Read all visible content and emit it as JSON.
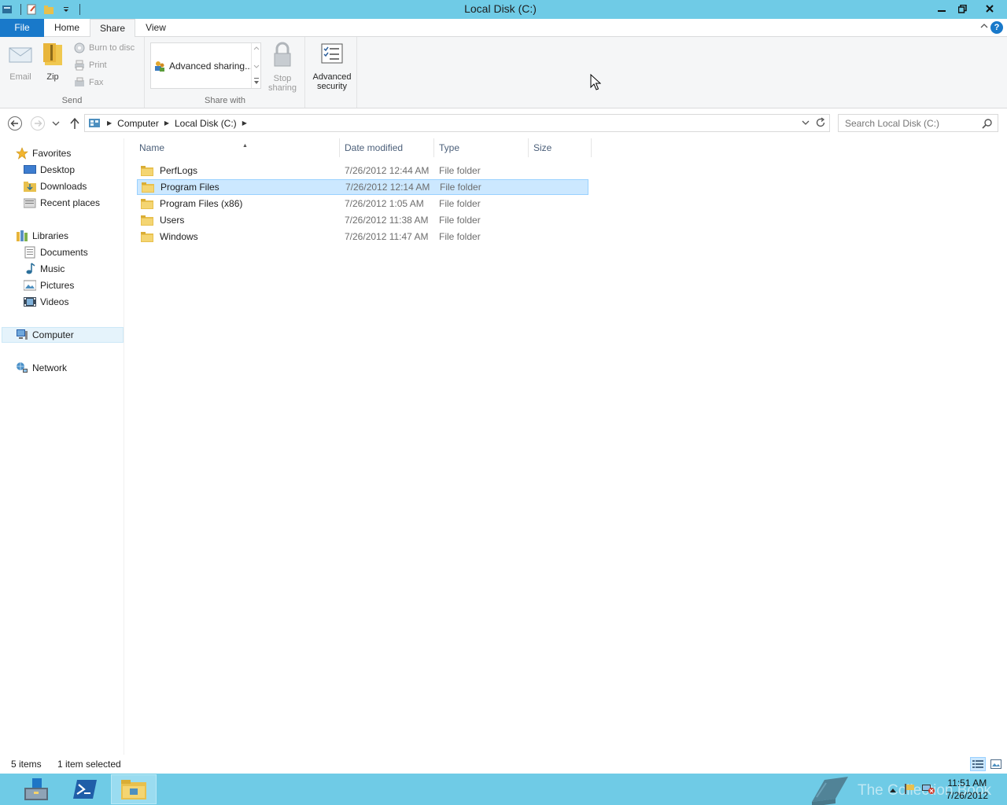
{
  "window": {
    "title": "Local Disk (C:)",
    "minimize_glyph": "─",
    "restore_glyph": "❐",
    "close_glyph": "✕"
  },
  "ribbon": {
    "tabs": {
      "file": "File",
      "home": "Home",
      "share": "Share",
      "view": "View"
    },
    "active_tab": "Share",
    "help_glyph": "?",
    "send": {
      "label": "Send",
      "email": "Email",
      "zip": "Zip",
      "burn": "Burn to disc",
      "print": "Print",
      "fax": "Fax"
    },
    "share_with": {
      "label": "Share with",
      "gallery_item": "Advanced sharing...",
      "stop_sharing_line1": "Stop",
      "stop_sharing_line2": "sharing"
    },
    "advanced_security_line1": "Advanced",
    "advanced_security_line2": "security"
  },
  "address": {
    "crumbs": [
      "Computer",
      "Local Disk (C:)"
    ]
  },
  "search": {
    "placeholder": "Search Local Disk (C:)"
  },
  "nav": {
    "favorites": "Favorites",
    "desktop": "Desktop",
    "downloads": "Downloads",
    "recent": "Recent places",
    "libraries": "Libraries",
    "documents": "Documents",
    "music": "Music",
    "pictures": "Pictures",
    "videos": "Videos",
    "computer": "Computer",
    "network": "Network"
  },
  "columns": {
    "name": "Name",
    "date": "Date modified",
    "type": "Type",
    "size": "Size"
  },
  "files": [
    {
      "name": "PerfLogs",
      "date": "7/26/2012 12:44 AM",
      "type": "File folder"
    },
    {
      "name": "Program Files",
      "date": "7/26/2012 12:14 AM",
      "type": "File folder",
      "selected": true
    },
    {
      "name": "Program Files (x86)",
      "date": "7/26/2012 1:05 AM",
      "type": "File folder"
    },
    {
      "name": "Users",
      "date": "7/26/2012 11:38 AM",
      "type": "File folder"
    },
    {
      "name": "Windows",
      "date": "7/26/2012 11:47 AM",
      "type": "File folder"
    }
  ],
  "status": {
    "count": "5 items",
    "selection": "1 item selected"
  },
  "taskbar": {
    "time": "11:51 AM",
    "date": "7/26/2012",
    "watermark": "The Collection Book"
  },
  "colors": {
    "titlebar": "#6fcbe6",
    "file_tab": "#1979ca",
    "selection": "#cce8ff",
    "selection_border": "#99d1ff"
  }
}
